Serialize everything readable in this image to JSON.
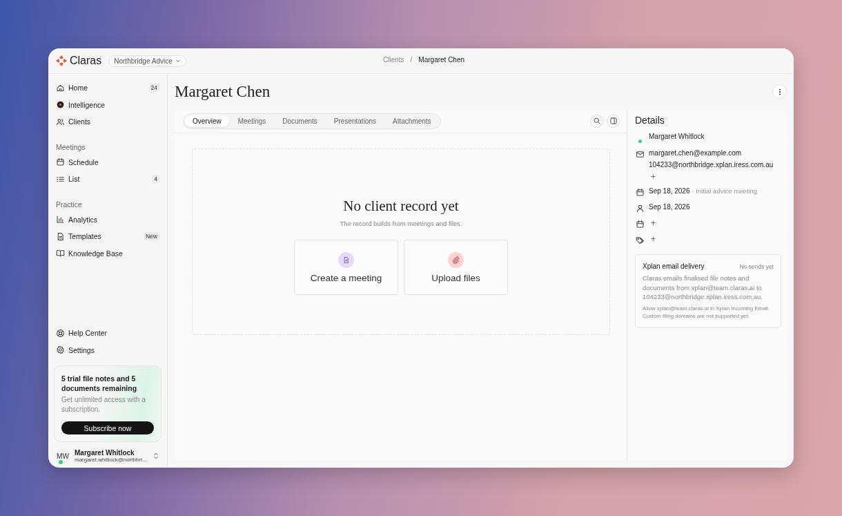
{
  "brand": {
    "name": "Claras"
  },
  "workspace": {
    "label": "Northbridge Advice"
  },
  "breadcrumb": [
    {
      "label": "Clients",
      "current": false
    },
    {
      "label": "/",
      "current": false
    },
    {
      "label": "Margaret Chen",
      "current": true
    }
  ],
  "sidebar": {
    "groups": [
      {
        "items": [
          {
            "label": "Home",
            "badge": "24",
            "selected": false
          },
          {
            "label": "Intelligence",
            "selected": false
          },
          {
            "label": "Clients",
            "selected": false
          }
        ]
      },
      {
        "heading": "Meetings",
        "items": [
          {
            "label": "Schedule",
            "selected": false
          },
          {
            "label": "List",
            "badge": "4",
            "selected": false
          }
        ]
      },
      {
        "heading": "Practice",
        "items": [
          {
            "label": "Analytics",
            "selected": false
          },
          {
            "label": "Templates",
            "badge": "New",
            "selected": false
          },
          {
            "label": "Knowledge Base",
            "selected": false
          }
        ]
      }
    ],
    "footer_items": [
      {
        "label": "Help Center",
        "selected": false
      },
      {
        "label": "Settings",
        "selected": false
      }
    ],
    "trial": {
      "title": "5 trial file notes and 5 documents remaining",
      "text": "Get unlimited access with a subscription.",
      "button": "Subscribe now"
    },
    "user": {
      "initials": "MW",
      "name": "Margaret Whitlock",
      "email": "margaret.whitlock@northbri...",
      "online": true
    }
  },
  "page": {
    "title": "Margaret Chen"
  },
  "tabs": [
    {
      "label": "Overview",
      "selected": true
    },
    {
      "label": "Meetings",
      "selected": false
    },
    {
      "label": "Documents",
      "selected": false
    },
    {
      "label": "Presentations",
      "selected": false
    },
    {
      "label": "Attachments",
      "selected": false
    }
  ],
  "empty_state": {
    "title": "No client record yet",
    "subtitle": "The record builds from meetings and files.",
    "actions": [
      {
        "kind": "meeting",
        "label": "Create a meeting"
      },
      {
        "kind": "upload",
        "label": "Upload files"
      }
    ]
  },
  "details": {
    "title": "Details",
    "items": [
      {
        "kind": "contact",
        "name": "Margaret Whitlock",
        "online": true
      },
      {
        "kind": "email",
        "values": [
          "margaret.chen@example.com",
          "104233@northbridge.xplan.iress.com.au"
        ],
        "add": "+"
      },
      {
        "kind": "meeting",
        "date": "Sep 18, 2026",
        "note": "· Initial advice meeting"
      },
      {
        "kind": "person",
        "date": "Sep 18, 2026"
      },
      {
        "kind": "calendar",
        "add": "+"
      },
      {
        "kind": "tag",
        "add": "+"
      }
    ],
    "delivery": {
      "title": "Xplan email delivery",
      "status": "No sends yet",
      "text": "Claras emails finalised file notes and documents from xplan@team.claras.ai to 104233@northbridge.xplan.iress.com.au.",
      "note": "Allow xplan@team.claras.ai in Xplan Incoming Email. Custom filing domains are not supported yet."
    }
  }
}
